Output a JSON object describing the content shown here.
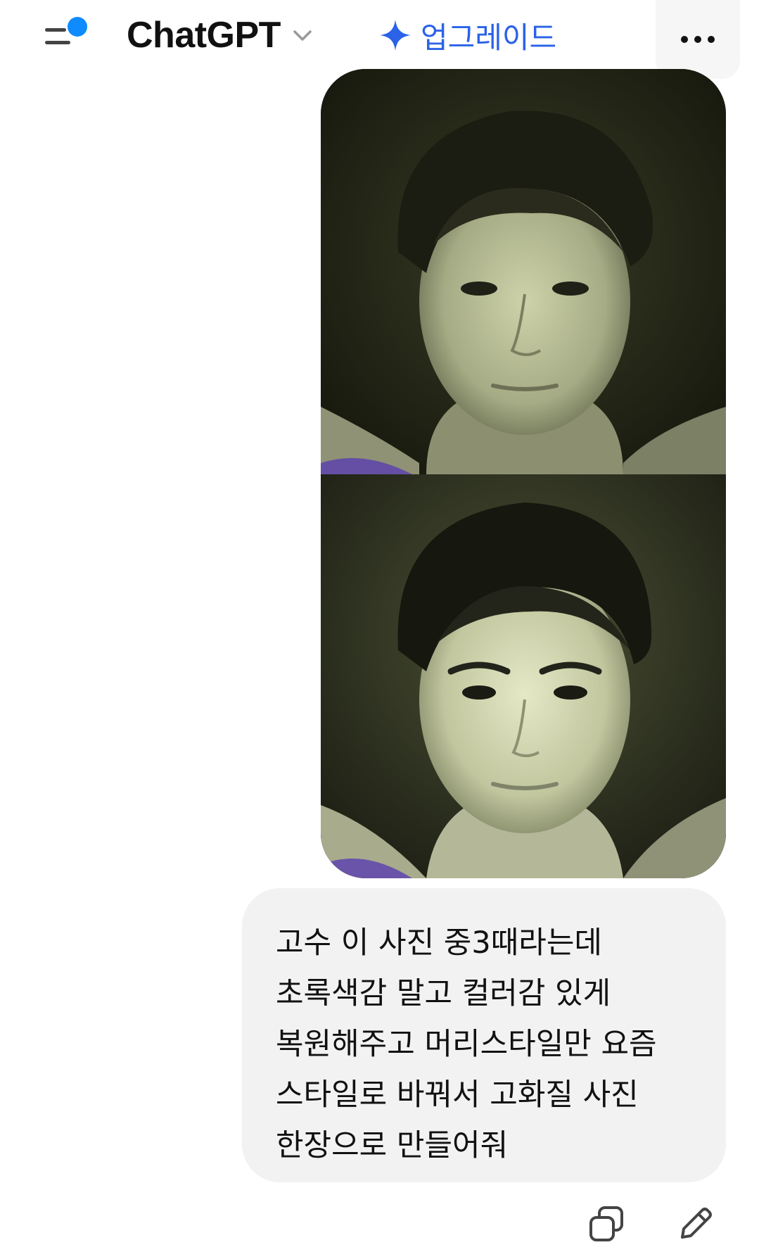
{
  "header": {
    "model_name": "ChatGPT",
    "upgrade_label": "업그레이드",
    "icons": {
      "menu": "sidebar-menu-icon",
      "chevron": "chevron-down-icon",
      "upgrade": "sparkle-icon",
      "more": "more-horizontal-icon"
    },
    "colors": {
      "accent": "#2a62e8",
      "notification_dot": "#0d8bff"
    }
  },
  "message": {
    "images": [
      {
        "description_name": "original-photo"
      },
      {
        "description_name": "restored-photo"
      }
    ],
    "text": "고수 이 사진 중3때라는데 초록색감 말고 컬러감 있게 복원해주고 머리스타일만 요즘 스타일로 바꿔서 고화질 사진 한장으로 만들어줘",
    "bubble_color": "#f2f2f2"
  },
  "actions": {
    "icons": {
      "copy": "copy-icon",
      "edit": "pencil-edit-icon"
    }
  }
}
